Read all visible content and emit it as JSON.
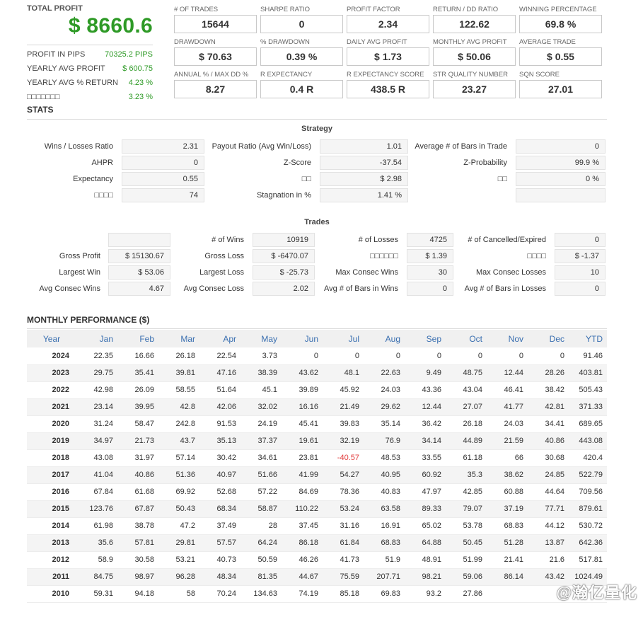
{
  "summary": {
    "total_profit_label": "TOTAL PROFIT",
    "total_profit_value": "$ 8660.6",
    "rows": [
      {
        "label": "PROFIT IN PIPS",
        "value": "70325.2 PIPS"
      },
      {
        "label": "YEARLY AVG PROFIT",
        "value": "$ 600.75"
      },
      {
        "label": "YEARLY AVG % RETURN",
        "value": "4.23 %"
      },
      {
        "label": "□□□□□□□",
        "value": "3.23 %"
      }
    ]
  },
  "stat_boxes": [
    {
      "label": "# OF TRADES",
      "value": "15644"
    },
    {
      "label": "SHARPE RATIO",
      "value": "0"
    },
    {
      "label": "PROFIT FACTOR",
      "value": "2.34"
    },
    {
      "label": "RETURN / DD RATIO",
      "value": "122.62"
    },
    {
      "label": "WINNING PERCENTAGE",
      "value": "69.8 %"
    },
    {
      "label": "DRAWDOWN",
      "value": "$ 70.63"
    },
    {
      "label": "% DRAWDOWN",
      "value": "0.39 %"
    },
    {
      "label": "DAILY AVG PROFIT",
      "value": "$ 1.73"
    },
    {
      "label": "MONTHLY AVG PROFIT",
      "value": "$ 50.06"
    },
    {
      "label": "AVERAGE TRADE",
      "value": "$ 0.55"
    },
    {
      "label": "ANNUAL % / MAX DD %",
      "value": "8.27"
    },
    {
      "label": "R EXPECTANCY",
      "value": "0.4 R"
    },
    {
      "label": "R EXPECTANCY SCORE",
      "value": "438.5 R"
    },
    {
      "label": "STR QUALITY NUMBER",
      "value": "23.27"
    },
    {
      "label": "SQN SCORE",
      "value": "27.01"
    }
  ],
  "stats": {
    "title": "STATS",
    "strategy_title": "Strategy",
    "strategy": [
      {
        "label": "Wins / Losses Ratio",
        "value": "2.31"
      },
      {
        "label": "Payout Ratio (Avg Win/Loss)",
        "value": "1.01"
      },
      {
        "label": "Average # of Bars in Trade",
        "value": "0"
      },
      {
        "label": "AHPR",
        "value": "0"
      },
      {
        "label": "Z-Score",
        "value": "-37.54"
      },
      {
        "label": "Z-Probability",
        "value": "99.9 %"
      },
      {
        "label": "Expectancy",
        "value": "0.55"
      },
      {
        "label": "□□",
        "value": "$ 2.98"
      },
      {
        "label": "□□",
        "value": "0 %"
      },
      {
        "label": "□□□□",
        "value": "74"
      },
      {
        "label": "Stagnation in %",
        "value": "1.41 %"
      },
      {
        "label": "",
        "value": ""
      }
    ],
    "trades_title": "Trades",
    "trades": [
      {
        "label": "",
        "value": ""
      },
      {
        "label": "# of Wins",
        "value": "10919"
      },
      {
        "label": "# of Losses",
        "value": "4725"
      },
      {
        "label": "# of Cancelled/Expired",
        "value": "0"
      },
      {
        "label": "Gross Profit",
        "value": "$ 15130.67"
      },
      {
        "label": "Gross Loss",
        "value": "$ -6470.07"
      },
      {
        "label": "□□□□□□",
        "value": "$ 1.39"
      },
      {
        "label": "□□□□",
        "value": "$ -1.37"
      },
      {
        "label": "Largest Win",
        "value": "$ 53.06"
      },
      {
        "label": "Largest Loss",
        "value": "$ -25.73"
      },
      {
        "label": "Max Consec Wins",
        "value": "30"
      },
      {
        "label": "Max Consec Losses",
        "value": "10"
      },
      {
        "label": "Avg Consec Wins",
        "value": "4.67"
      },
      {
        "label": "Avg Consec Loss",
        "value": "2.02"
      },
      {
        "label": "Avg # of Bars in Wins",
        "value": "0"
      },
      {
        "label": "Avg # of Bars in Losses",
        "value": "0"
      }
    ]
  },
  "monthly": {
    "title": "MONTHLY PERFORMANCE ($)",
    "headers": [
      "Year",
      "Jan",
      "Feb",
      "Mar",
      "Apr",
      "May",
      "Jun",
      "Jul",
      "Aug",
      "Sep",
      "Oct",
      "Nov",
      "Dec",
      "YTD"
    ],
    "rows": [
      [
        "2024",
        "22.35",
        "16.66",
        "26.18",
        "22.54",
        "3.73",
        "0",
        "0",
        "0",
        "0",
        "0",
        "0",
        "0",
        "91.46"
      ],
      [
        "2023",
        "29.75",
        "35.41",
        "39.81",
        "47.16",
        "38.39",
        "43.62",
        "48.1",
        "22.63",
        "9.49",
        "48.75",
        "12.44",
        "28.26",
        "403.81"
      ],
      [
        "2022",
        "42.98",
        "26.09",
        "58.55",
        "51.64",
        "45.1",
        "39.89",
        "45.92",
        "24.03",
        "43.36",
        "43.04",
        "46.41",
        "38.42",
        "505.43"
      ],
      [
        "2021",
        "23.14",
        "39.95",
        "42.8",
        "42.06",
        "32.02",
        "16.16",
        "21.49",
        "29.62",
        "12.44",
        "27.07",
        "41.77",
        "42.81",
        "371.33"
      ],
      [
        "2020",
        "31.24",
        "58.47",
        "242.8",
        "91.53",
        "24.19",
        "45.41",
        "39.83",
        "35.14",
        "36.42",
        "26.18",
        "24.03",
        "34.41",
        "689.65"
      ],
      [
        "2019",
        "34.97",
        "21.73",
        "43.7",
        "35.13",
        "37.37",
        "19.61",
        "32.19",
        "76.9",
        "34.14",
        "44.89",
        "21.59",
        "40.86",
        "443.08"
      ],
      [
        "2018",
        "43.08",
        "31.97",
        "57.14",
        "30.42",
        "34.61",
        "23.81",
        "-40.57",
        "48.53",
        "33.55",
        "61.18",
        "66",
        "30.68",
        "420.4"
      ],
      [
        "2017",
        "41.04",
        "40.86",
        "51.36",
        "40.97",
        "51.66",
        "41.99",
        "54.27",
        "40.95",
        "60.92",
        "35.3",
        "38.62",
        "24.85",
        "522.79"
      ],
      [
        "2016",
        "67.84",
        "61.68",
        "69.92",
        "52.68",
        "57.22",
        "84.69",
        "78.36",
        "40.83",
        "47.97",
        "42.85",
        "60.88",
        "44.64",
        "709.56"
      ],
      [
        "2015",
        "123.76",
        "67.87",
        "50.43",
        "68.34",
        "58.87",
        "110.22",
        "53.24",
        "63.58",
        "89.33",
        "79.07",
        "37.19",
        "77.71",
        "879.61"
      ],
      [
        "2014",
        "61.98",
        "38.78",
        "47.2",
        "37.49",
        "28",
        "37.45",
        "31.16",
        "16.91",
        "65.02",
        "53.78",
        "68.83",
        "44.12",
        "530.72"
      ],
      [
        "2013",
        "35.6",
        "57.81",
        "29.81",
        "57.57",
        "64.24",
        "86.18",
        "61.84",
        "68.83",
        "64.88",
        "50.45",
        "51.28",
        "13.87",
        "642.36"
      ],
      [
        "2012",
        "58.9",
        "30.58",
        "53.21",
        "40.73",
        "50.59",
        "46.26",
        "41.73",
        "51.9",
        "48.91",
        "51.99",
        "21.41",
        "21.6",
        "517.81"
      ],
      [
        "2011",
        "84.75",
        "98.97",
        "96.28",
        "48.34",
        "81.35",
        "44.67",
        "75.59",
        "207.71",
        "98.21",
        "59.06",
        "86.14",
        "43.42",
        "1024.49"
      ],
      [
        "2010",
        "59.31",
        "94.18",
        "58",
        "70.24",
        "134.63",
        "74.19",
        "85.18",
        "69.83",
        "93.2",
        "27.86",
        "",
        "",
        ""
      ]
    ],
    "negative_color": "#e23b3b"
  },
  "watermark": "@瀚亿量化"
}
